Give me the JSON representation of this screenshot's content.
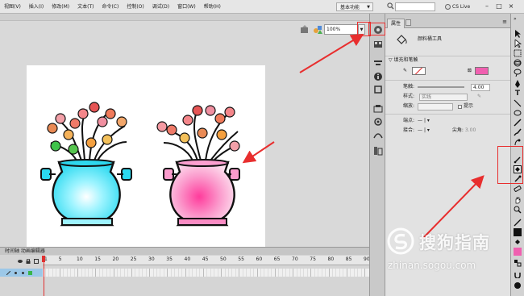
{
  "menubar": {
    "items": [
      "视图(V)",
      "插入(I)",
      "修改(M)",
      "文本(T)",
      "命令(C)",
      "控制(O)",
      "调试(D)",
      "窗口(W)",
      "帮助(H)"
    ],
    "workspace": "基本功能",
    "cslive": "CS Live"
  },
  "stage": {
    "zoom": "100%"
  },
  "timeline": {
    "title": "时间轴 动画编辑器",
    "frame_numbers": [
      "1",
      "5",
      "10",
      "15",
      "20",
      "25",
      "30",
      "35",
      "40",
      "45",
      "50",
      "55",
      "60",
      "65",
      "70",
      "75",
      "80",
      "85",
      "90"
    ]
  },
  "properties": {
    "tab_label": "属性",
    "tool_name": "颜料桶工具",
    "section_title": "填充和笔触",
    "stroke_width_label": "笔触:",
    "stroke_width_value": "4.00",
    "style_label": "样式:",
    "style_value": "实线",
    "scale_label": "缩放:",
    "hint_label": "提示",
    "cap_label": "端点:",
    "join_label": "接合:",
    "miter_label": "尖角:",
    "miter_value": "3.00",
    "stroke_color": "#f0a0c8",
    "fill_color": "#f060b0"
  },
  "watermark": {
    "text": "搜狗指南",
    "url": "zhinan.sogou.com"
  },
  "colors": {
    "highlight": "#e82e2e",
    "fill_swatch": "#f060b0"
  }
}
